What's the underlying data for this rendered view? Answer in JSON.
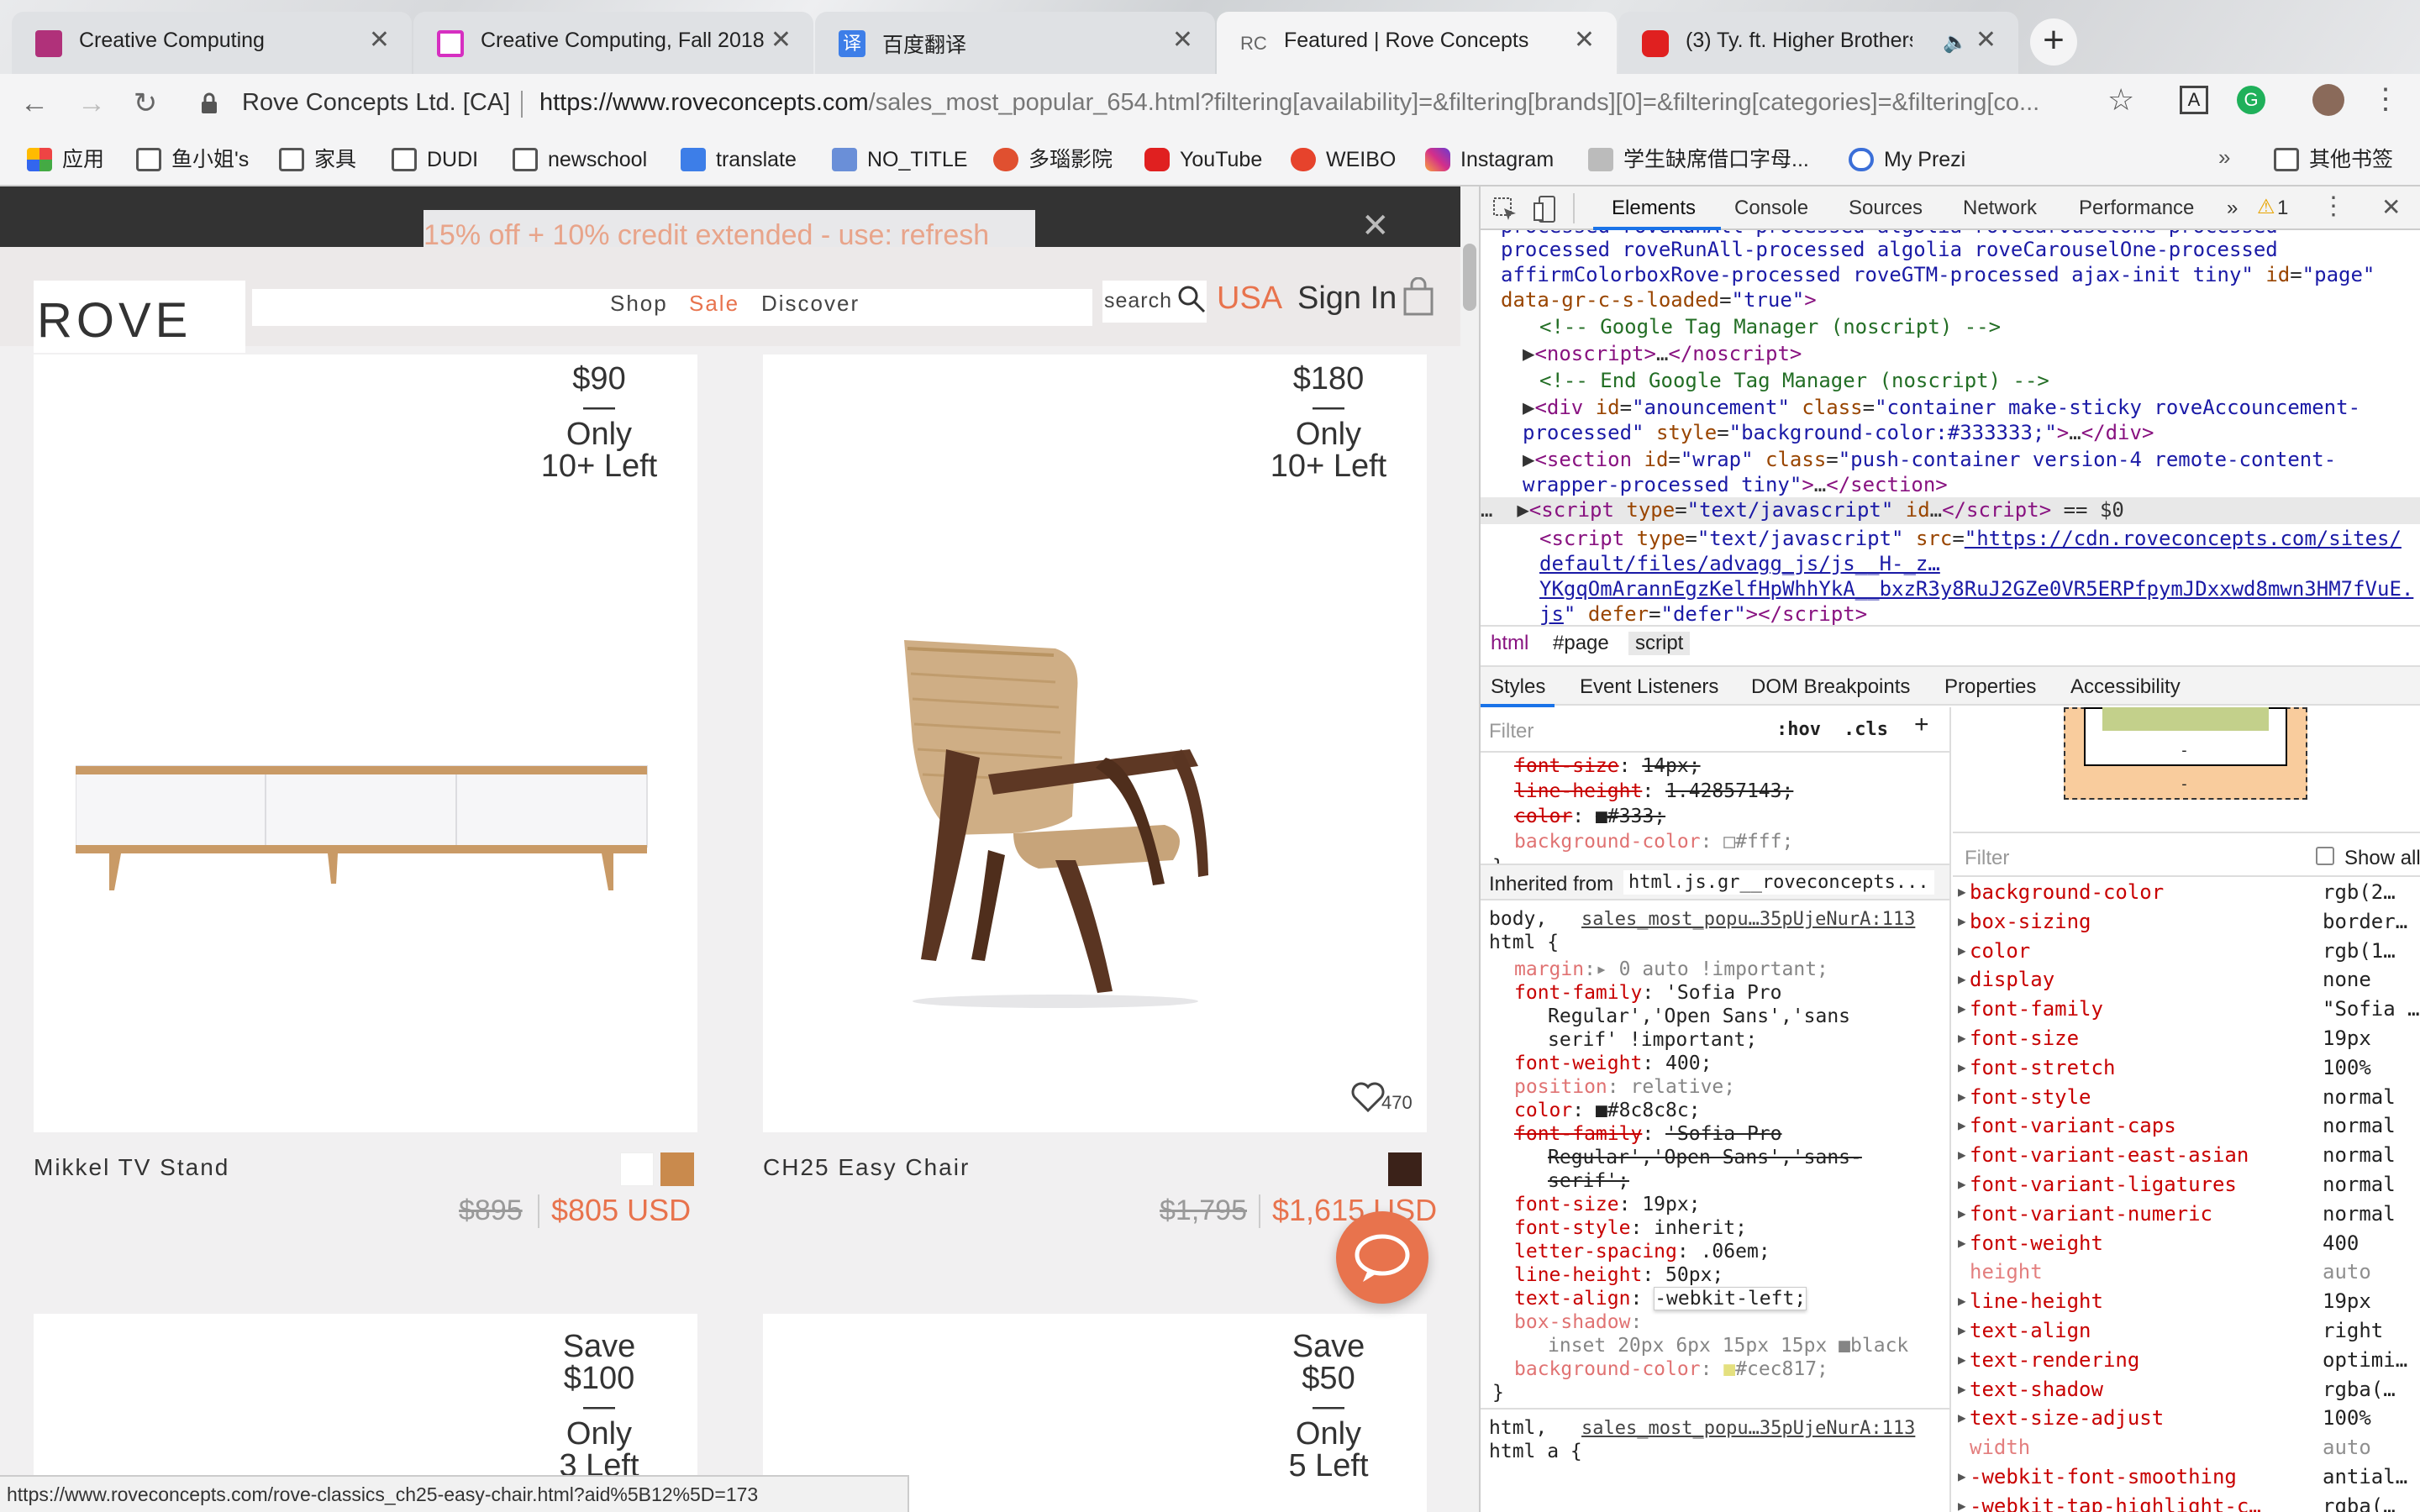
{
  "browser": {
    "tabs": [
      {
        "title": "Creative Computing",
        "color": "#b0317a"
      },
      {
        "title": "Creative Computing, Fall 2018",
        "color": "#d62fc1"
      },
      {
        "title": "百度翻译",
        "color": "#3d7ee8"
      },
      {
        "title": "Featured | Rove Concepts",
        "color": "#888888"
      },
      {
        "title": "(3) Ty. ft. Higher Brothers -",
        "color": "#e02020"
      }
    ],
    "new_tab": "+",
    "site_name": "Rove Concepts Ltd. [CA]",
    "url_host": "https://www.roveconcepts.com",
    "url_path": "/sales_most_popular_654.html?filtering[availability]=&filtering[brands][0]=&filtering[categories]=&filtering[co...",
    "bookmarks": [
      "应用",
      "鱼小姐's",
      "家具",
      "DUDI",
      "newschool",
      "translate",
      "NO_TITLE",
      "多瑙影院",
      "YouTube",
      "WEIBO",
      "Instagram",
      "学生缺席借口字母...",
      "My Prezi"
    ],
    "other_bookmarks": "其他书签",
    "status_url": "https://www.roveconcepts.com/rove-classics_ch25-easy-chair.html?aid%5B12%5D=173"
  },
  "site": {
    "promo": "15% off + 10% credit extended - use: refresh",
    "logo": "ROVE",
    "nav": [
      "Shop",
      "Sale",
      "Discover"
    ],
    "search_label": "search",
    "region": "USA",
    "sign_in": "Sign In",
    "accent": "#e8734d",
    "products": [
      {
        "badge_price": "$90",
        "badge_dash": "—",
        "badge_only": "Only",
        "badge_left": "10+ Left",
        "name": "Mikkel TV Stand",
        "old_price": "$895",
        "new_price": "$805 USD"
      },
      {
        "badge_price": "$180",
        "badge_dash": "—",
        "badge_only": "Only",
        "badge_left": "10+ Left",
        "name": "CH25 Easy Chair",
        "old_price": "$1,795",
        "new_price": "$1,615 USD",
        "likes": "470"
      }
    ],
    "row2": [
      {
        "save": "Save",
        "amount": "$100",
        "dash": "—",
        "only": "Only",
        "left": "3 Left"
      },
      {
        "save": "Save",
        "amount": "$50",
        "dash": "—",
        "only": "Only",
        "left": "5 Left"
      }
    ]
  },
  "devtools": {
    "tabs": [
      "Elements",
      "Console",
      "Sources",
      "Network",
      "Performance",
      "»"
    ],
    "warnings": "1",
    "breadcrumb": [
      "html",
      "#page",
      "script"
    ],
    "panel_tabs": [
      "Styles",
      "Event Listeners",
      "DOM Breakpoints",
      "Properties",
      "Accessibility"
    ],
    "filter": "Filter",
    "hov": ":hov",
    "cls": ".cls",
    "inherited_label": "Inherited from",
    "inherited_from": "html.js.gr__roveconcepts...",
    "rule_source": "sales_most_popu…35pUjeNurA:113",
    "show_all": "Show all",
    "computed": [
      {
        "p": "background-color",
        "v": "rgb(2…",
        "dim": false
      },
      {
        "p": "box-sizing",
        "v": "border…",
        "dim": false
      },
      {
        "p": "color",
        "v": "rgb(1…",
        "dim": false
      },
      {
        "p": "display",
        "v": "none",
        "dim": false
      },
      {
        "p": "font-family",
        "v": "\"Sofia …",
        "dim": false
      },
      {
        "p": "font-size",
        "v": "19px",
        "dim": false
      },
      {
        "p": "font-stretch",
        "v": "100%",
        "dim": false
      },
      {
        "p": "font-style",
        "v": "normal",
        "dim": false
      },
      {
        "p": "font-variant-caps",
        "v": "normal",
        "dim": false
      },
      {
        "p": "font-variant-east-asian",
        "v": "normal",
        "dim": false
      },
      {
        "p": "font-variant-ligatures",
        "v": "normal",
        "dim": false
      },
      {
        "p": "font-variant-numeric",
        "v": "normal",
        "dim": false
      },
      {
        "p": "font-weight",
        "v": "400",
        "dim": false
      },
      {
        "p": "height",
        "v": "auto",
        "dim": true
      },
      {
        "p": "line-height",
        "v": "19px",
        "dim": false
      },
      {
        "p": "text-align",
        "v": "right",
        "dim": false
      },
      {
        "p": "text-rendering",
        "v": "optimi…",
        "dim": false
      },
      {
        "p": "text-shadow",
        "v": "rgba(…",
        "dim": false
      },
      {
        "p": "text-size-adjust",
        "v": "100%",
        "dim": false
      },
      {
        "p": "width",
        "v": "auto",
        "dim": true
      },
      {
        "p": "-webkit-font-smoothing",
        "v": "antial…",
        "dim": false
      },
      {
        "p": "-webkit-tap-highlight-c…",
        "v": "rgba(…",
        "dim": false
      }
    ]
  }
}
